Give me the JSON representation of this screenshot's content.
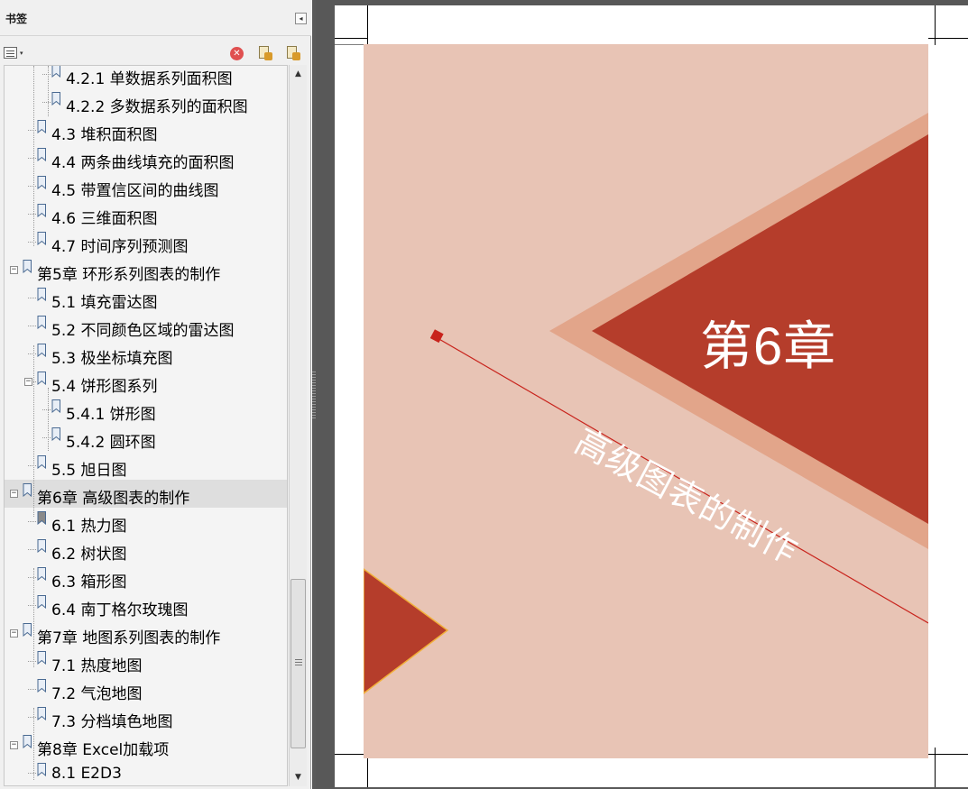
{
  "panel": {
    "title": "书签",
    "collapse_glyph": "◂",
    "options_arrow_glyph": "▾",
    "delete_glyph": "✕",
    "icons": {
      "options": "bookmark-options-icon",
      "delete": "delete-bookmark-icon",
      "new": "new-bookmark-icon",
      "expand": "expand-bookmark-icon"
    }
  },
  "tree": {
    "items": [
      {
        "label": "4.2.1  单数据系列面积图",
        "level": 2
      },
      {
        "label": "4.2.2  多数据系列的面积图",
        "level": 2
      },
      {
        "label": "4.3  堆积面积图",
        "level": 1
      },
      {
        "label": "4.4  两条曲线填充的面积图",
        "level": 1
      },
      {
        "label": "4.5  带置信区间的曲线图",
        "level": 1
      },
      {
        "label": "4.6  三维面积图",
        "level": 1
      },
      {
        "label": "4.7  时间序列预测图",
        "level": 1
      },
      {
        "label": "第5章  环形系列图表的制作",
        "level": 0,
        "toggle": "−"
      },
      {
        "label": "5.1  填充雷达图",
        "level": 1
      },
      {
        "label": "5.2  不同颜色区域的雷达图",
        "level": 1
      },
      {
        "label": "5.3  极坐标填充图",
        "level": 1
      },
      {
        "label": "5.4  饼形图系列",
        "level": 1,
        "toggle": "−"
      },
      {
        "label": "5.4.1  饼形图",
        "level": 2
      },
      {
        "label": "5.4.2  圆环图",
        "level": 2
      },
      {
        "label": "5.5  旭日图",
        "level": 1
      },
      {
        "label": "第6章  高级图表的制作",
        "level": 0,
        "toggle": "−",
        "selected": true
      },
      {
        "label": "6.1  热力图",
        "level": 1,
        "active": true
      },
      {
        "label": "6.2  树状图",
        "level": 1
      },
      {
        "label": "6.3  箱形图",
        "level": 1
      },
      {
        "label": "6.4  南丁格尔玫瑰图",
        "level": 1
      },
      {
        "label": "第7章  地图系列图表的制作",
        "level": 0,
        "toggle": "−"
      },
      {
        "label": "7.1  热度地图",
        "level": 1
      },
      {
        "label": "7.2  气泡地图",
        "level": 1
      },
      {
        "label": "7.3  分档填色地图",
        "level": 1
      },
      {
        "label": "第8章  Excel加载项",
        "level": 0,
        "toggle": "−"
      },
      {
        "label": "8.1  E2D3",
        "level": 1
      }
    ]
  },
  "scrollbar": {
    "up_glyph": "▲",
    "down_glyph": "▼"
  },
  "cover": {
    "chapter": "第6章",
    "title": "高级图表的制作",
    "colors": {
      "background": "#e8c4b5",
      "band": "#e2a58a",
      "triangle": "#b53d2b",
      "line": "#c8231c",
      "small_triangle_edge": "#f1b03a"
    }
  }
}
